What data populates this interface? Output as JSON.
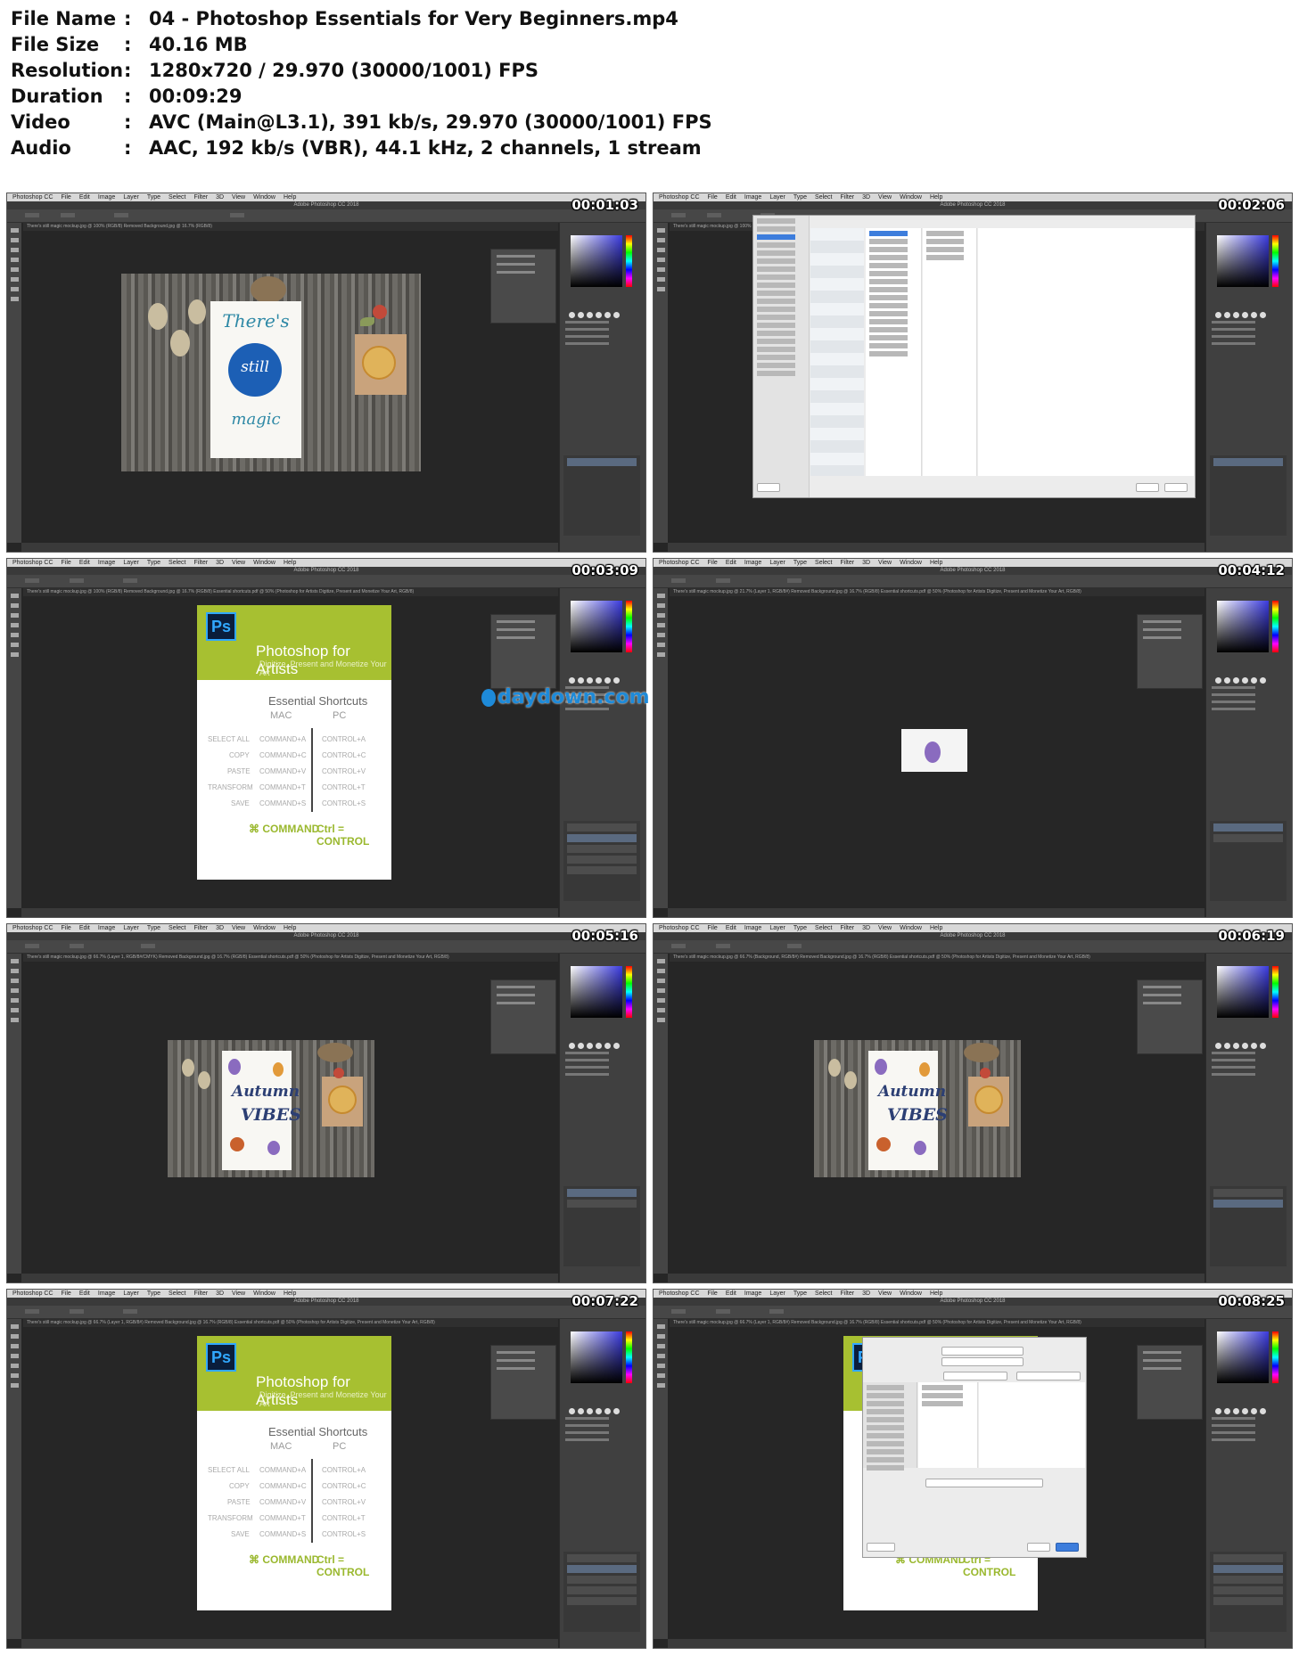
{
  "file_info": [
    {
      "key": "File Name",
      "value": "04 - Photoshop Essentials for Very Beginners.mp4"
    },
    {
      "key": "File Size",
      "value": "40.16 MB"
    },
    {
      "key": "Resolution",
      "value": "1280x720 / 29.970 (30000/1001) FPS"
    },
    {
      "key": "Duration",
      "value": "00:09:29"
    },
    {
      "key": "Video",
      "value": "AVC (Main@L3.1), 391 kb/s, 29.970 (30000/1001) FPS"
    },
    {
      "key": "Audio",
      "value": "AAC, 192 kb/s (VBR), 44.1 kHz, 2 channels, 1 stream"
    }
  ],
  "separator": ":",
  "app": {
    "menu": [
      "Photoshop CC",
      "File",
      "Edit",
      "Image",
      "Layer",
      "Type",
      "Select",
      "Filter",
      "3D",
      "View",
      "Window",
      "Help"
    ],
    "window_title": "Adobe Photoshop CC 2018"
  },
  "thumbnails": [
    {
      "time": "00:01:03",
      "tab": "There's still magic mockup.jpg @ 100% (RGB/8)   Removed Background.jpg @ 16.7% (RGB/8)"
    },
    {
      "time": "00:02:06",
      "tab": "There's still magic mockup.jpg @ 100% (RGB/8)"
    },
    {
      "time": "00:03:09",
      "tab": "There's still magic mockup.jpg @ 100% (RGB/8)   Removed Background.jpg @ 16.7% (RGB/8)   Essential shortcuts.pdf @ 50% (Photoshop for Artists   Digitize, Present and Monetize Your Art, RGB/8)"
    },
    {
      "time": "00:04:12",
      "tab": "There's still magic mockup.jpg @ 21.7% (Layer 1, RGB/8#)   Removed Background.jpg @ 16.7% (RGB/8)   Essential shortcuts.pdf @ 50% (Photoshop for Artists   Digitize, Present and Monetize Your Art, RGB/8)"
    },
    {
      "time": "00:05:16",
      "tab": "There's still magic mockup.jpg @ 66.7% (Layer 1, RGB/8#/CMYK)   Removed Background.jpg @ 16.7% (RGB/8)   Essential shortcuts.pdf @ 50% (Photoshop for Artists   Digitize, Present and Monetize Your Art, RGB/8)"
    },
    {
      "time": "00:06:19",
      "tab": "There's still magic mockup.jpg @ 66.7% (Background, RGB/8#)   Removed Background.jpg @ 16.7% (RGB/8)   Essential shortcuts.pdf @ 50% (Photoshop for Artists   Digitize, Present and Monetize Your Art, RGB/8)"
    },
    {
      "time": "00:07:22",
      "tab": "There's still magic mockup.jpg @ 66.7% (Layer 1, RGB/8#)   Removed Background.jpg @ 16.7% (RGB/8)   Essential shortcuts.pdf @ 50% (Photoshop for Artists   Digitize, Present and Monetize Your Art, RGB/8)"
    },
    {
      "time": "00:08:25",
      "tab": "There's still magic mockup.jpg @ 66.7% (Layer 1, RGB/8#)   Removed Background.jpg @ 16.7% (RGB/8)   Essential shortcuts.pdf @ 50% (Photoshop for Artists   Digitize, Present and Monetize Your Art, RGB/8)"
    }
  ],
  "card_text": [
    "There's",
    "still",
    "magic"
  ],
  "autumn_text": [
    "Autumn",
    "VIBES"
  ],
  "shortcuts_doc": {
    "logo": "Ps",
    "title": "Photoshop for Artists",
    "subtitle": "Digitize, Present and Monetize Your Art",
    "heading": "Essential Shortcuts",
    "col_mac": "MAC",
    "col_pc": "PC",
    "rows": [
      {
        "label": "SELECT ALL",
        "mac": "COMMAND+A",
        "pc": "CONTROL+A"
      },
      {
        "label": "COPY",
        "mac": "COMMAND+C",
        "pc": "CONTROL+C"
      },
      {
        "label": "PASTE",
        "mac": "COMMAND+V",
        "pc": "CONTROL+V"
      },
      {
        "label": "TRANSFORM",
        "mac": "COMMAND+T",
        "pc": "CONTROL+T"
      },
      {
        "label": "SAVE",
        "mac": "COMMAND+S",
        "pc": "CONTROL+S"
      }
    ],
    "footer_mac": "⌘ COMMAND",
    "footer_pc": "Ctrl = CONTROL"
  },
  "watermark": "daydown.com",
  "colors": {
    "ui_dark": "#262626",
    "panel": "#404040",
    "doc_green": "#a7c031",
    "ps_blue": "#31a8ff",
    "watermark": "#1e8ad8"
  }
}
